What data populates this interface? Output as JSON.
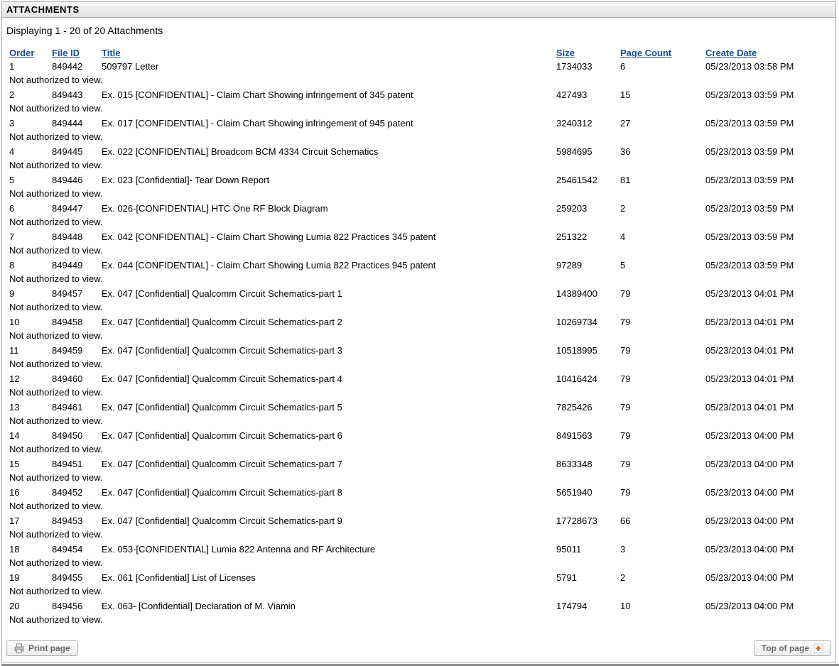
{
  "header": {
    "title": "ATTACHMENTS"
  },
  "summary": "Displaying 1 - 20 of 20 Attachments",
  "columns": {
    "order": "Order",
    "fileid": "File ID",
    "title": "Title",
    "size": "Size",
    "pages": "Page Count",
    "date": "Create Date"
  },
  "noauth_text": "Not authorized to view.",
  "rows": [
    {
      "order": "1",
      "fileid": "849442",
      "title": "509797 Letter",
      "size": "1734033",
      "pages": "6",
      "date": "05/23/2013 03:58 PM"
    },
    {
      "order": "2",
      "fileid": "849443",
      "title": "Ex. 015 [CONFIDENTIAL] - Claim Chart Showing infringement of 345 patent",
      "size": "427493",
      "pages": "15",
      "date": "05/23/2013 03:59 PM"
    },
    {
      "order": "3",
      "fileid": "849444",
      "title": "Ex. 017 [CONFIDENTIAL] - Claim Chart Showing infringement of 945 patent",
      "size": "3240312",
      "pages": "27",
      "date": "05/23/2013 03:59 PM"
    },
    {
      "order": "4",
      "fileid": "849445",
      "title": "Ex. 022 [CONFIDENTIAL] Broadcom BCM 4334 Circuit Schematics",
      "size": "5984695",
      "pages": "36",
      "date": "05/23/2013 03:59 PM"
    },
    {
      "order": "5",
      "fileid": "849446",
      "title": "Ex. 023 [Confidential]- Tear Down Report",
      "size": "25461542",
      "pages": "81",
      "date": "05/23/2013 03:59 PM"
    },
    {
      "order": "6",
      "fileid": "849447",
      "title": "Ex. 026-[CONFIDENTIAL] HTC One RF Block Diagram",
      "size": "259203",
      "pages": "2",
      "date": "05/23/2013 03:59 PM"
    },
    {
      "order": "7",
      "fileid": "849448",
      "title": "Ex. 042 [CONFIDENTIAL] - Claim Chart Showing Lumia 822 Practices 345 patent",
      "size": "251322",
      "pages": "4",
      "date": "05/23/2013 03:59 PM"
    },
    {
      "order": "8",
      "fileid": "849449",
      "title": "Ex. 044 [CONFIDENTIAL] - Claim Chart Showing Lumia 822 Practices 945 patent",
      "size": "97289",
      "pages": "5",
      "date": "05/23/2013 03:59 PM"
    },
    {
      "order": "9",
      "fileid": "849457",
      "title": "Ex. 047 [Confidential] Qualcomm Circuit Schematics-part 1",
      "size": "14389400",
      "pages": "79",
      "date": "05/23/2013 04:01 PM"
    },
    {
      "order": "10",
      "fileid": "849458",
      "title": "Ex. 047 [Confidential] Qualcomm Circuit Schematics-part 2",
      "size": "10269734",
      "pages": "79",
      "date": "05/23/2013 04:01 PM"
    },
    {
      "order": "11",
      "fileid": "849459",
      "title": "Ex. 047 [Confidential] Qualcomm Circuit Schematics-part 3",
      "size": "10518995",
      "pages": "79",
      "date": "05/23/2013 04:01 PM"
    },
    {
      "order": "12",
      "fileid": "849460",
      "title": "Ex. 047 [Confidential] Qualcomm Circuit Schematics-part 4",
      "size": "10416424",
      "pages": "79",
      "date": "05/23/2013 04:01 PM"
    },
    {
      "order": "13",
      "fileid": "849461",
      "title": "Ex. 047 [Confidential] Qualcomm Circuit Schematics-part 5",
      "size": "7825426",
      "pages": "79",
      "date": "05/23/2013 04:01 PM"
    },
    {
      "order": "14",
      "fileid": "849450",
      "title": "Ex. 047 [Confidential] Qualcomm Circuit Schematics-part 6",
      "size": "8491563",
      "pages": "79",
      "date": "05/23/2013 04:00 PM"
    },
    {
      "order": "15",
      "fileid": "849451",
      "title": "Ex. 047 [Confidential] Qualcomm Circuit Schematics-part 7",
      "size": "8633348",
      "pages": "79",
      "date": "05/23/2013 04:00 PM"
    },
    {
      "order": "16",
      "fileid": "849452",
      "title": "Ex. 047 [Confidential] Qualcomm Circuit Schematics-part 8",
      "size": "5651940",
      "pages": "79",
      "date": "05/23/2013 04:00 PM"
    },
    {
      "order": "17",
      "fileid": "849453",
      "title": "Ex. 047 [Confidential] Qualcomm Circuit Schematics-part 9",
      "size": "17728673",
      "pages": "66",
      "date": "05/23/2013 04:00 PM"
    },
    {
      "order": "18",
      "fileid": "849454",
      "title": "Ex. 053-[CONFIDENTIAL] Lumia 822 Antenna and RF Architecture",
      "size": "95011",
      "pages": "3",
      "date": "05/23/2013 04:00 PM"
    },
    {
      "order": "19",
      "fileid": "849455",
      "title": "Ex. 061 [Confidential] List of Licenses",
      "size": "5791",
      "pages": "2",
      "date": "05/23/2013 04:00 PM"
    },
    {
      "order": "20",
      "fileid": "849456",
      "title": "Ex. 063- [Confidential] Declaration of M. Viamin",
      "size": "174794",
      "pages": "10",
      "date": "05/23/2013 04:00 PM"
    }
  ],
  "buttons": {
    "print": "Print page",
    "top": "Top of page"
  }
}
